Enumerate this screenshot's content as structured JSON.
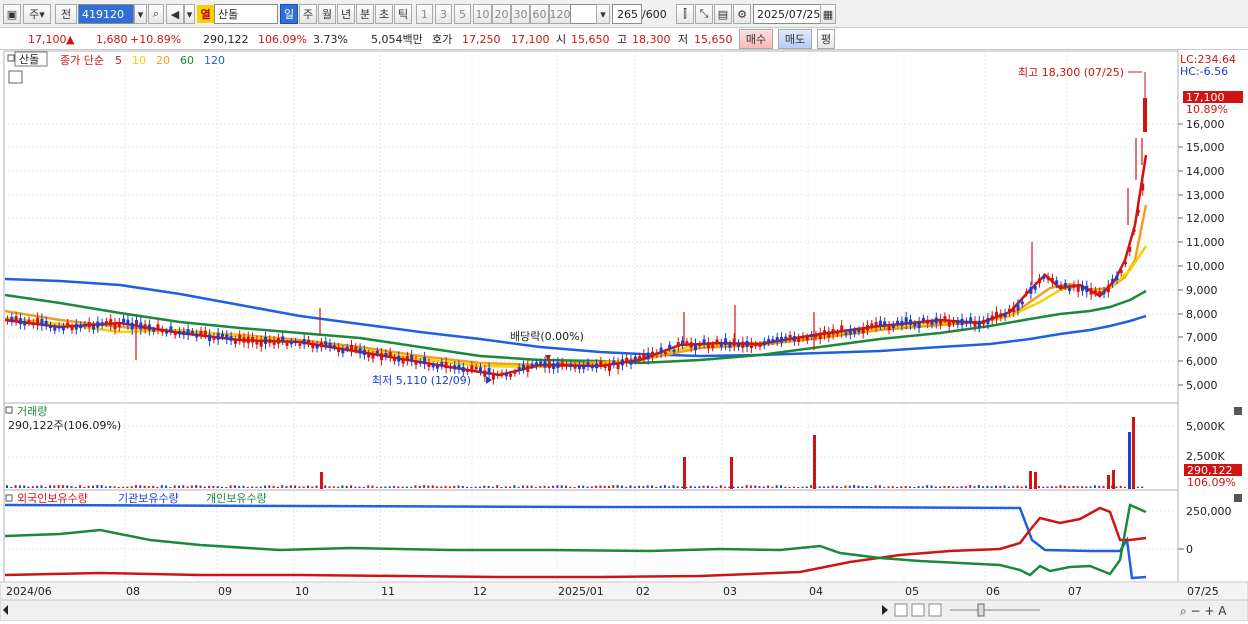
{
  "toolbar": {
    "tab_stock": "주",
    "tab_prev": "전",
    "code": "419120",
    "market_badge": "열",
    "name": "산돌",
    "periods": [
      "일",
      "주",
      "월",
      "년",
      "분",
      "초",
      "틱"
    ],
    "period_selected": "일",
    "intervals": [
      "1",
      "3",
      "5",
      "10",
      "20",
      "30",
      "60",
      "120"
    ],
    "count_value": "265",
    "count_total": "/600",
    "date": "2025/07/25"
  },
  "quote": {
    "price": "17,100",
    "arrow": "▲",
    "change": "1,680",
    "change_pct": "+10.89%",
    "volume": "290,122",
    "vol_ratio": "106.09%",
    "turnover": "3.73%",
    "amount": "5,054백만",
    "ask_label": "호가",
    "ask1": "17,250",
    "ask2": "17,100",
    "open_label": "시",
    "open": "15,650",
    "high_label": "고",
    "high": "18,300",
    "low_label": "저",
    "low": "15,650",
    "buy": "매수",
    "sell": "매도",
    "avg": "평"
  },
  "legend": {
    "name": "산돌",
    "ma_title": "종가 단순",
    "ma": [
      {
        "label": "5",
        "color": "#d01414"
      },
      {
        "label": "10",
        "color": "#f5d200"
      },
      {
        "label": "20",
        "color": "#f0a020"
      },
      {
        "label": "60",
        "color": "#1a8a3a"
      },
      {
        "label": "120",
        "color": "#2060e0"
      }
    ]
  },
  "annotations": {
    "high": "최고 18,300 (07/25)",
    "low": "최저 5,110 (12/09)",
    "dividend": "배당락(0.00%)",
    "lc": "LC:234.64",
    "hc": "HC:-6.56",
    "price_tag": "17,100",
    "pct_tag": "10.89%"
  },
  "price_axis": [
    "16,000",
    "15,000",
    "14,000",
    "13,000",
    "12,000",
    "11,000",
    "10,000",
    "9,000",
    "8,000",
    "7,000",
    "6,000",
    "5,000"
  ],
  "volume_panel": {
    "title": "거래량",
    "value": "290,122주(106.09%)",
    "axis": [
      "5,000K",
      "2,500K"
    ],
    "tag1": "290,122",
    "tag2": "106.09%"
  },
  "holder_panel": {
    "titles": [
      "외국인보유수량",
      "기관보유수량",
      "개인보유수량"
    ],
    "axis": [
      "250,000",
      "0"
    ]
  },
  "x_axis": [
    "2024/06",
    "08",
    "09",
    "10",
    "11",
    "12",
    "2025/01",
    "02",
    "03",
    "04",
    "05",
    "06",
    "07",
    "07/25"
  ],
  "colors": {
    "up": "#d01414",
    "down": "#1a3fd0",
    "ma5": "#d01414",
    "ma10": "#f5d200",
    "ma20": "#f0a020",
    "ma60": "#1a8a3a",
    "ma120": "#2060e0"
  }
}
